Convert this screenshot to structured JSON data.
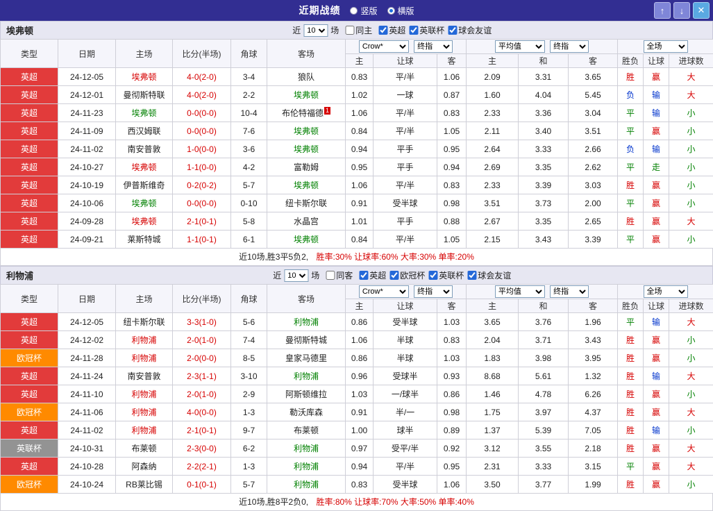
{
  "colors": {
    "topbar_bg": "#322e92",
    "epl_badge": "#e23b3b",
    "ucl_badge": "#ff8a00",
    "eflcup_badge": "#939393",
    "win_red": "#d60000",
    "draw_green": "#008000",
    "lose_blue": "#0033cc"
  },
  "topbar": {
    "title": "近期战绩",
    "layout_options": [
      {
        "label": "竖版",
        "selected": false
      },
      {
        "label": "横版",
        "selected": true
      }
    ],
    "up_icon": "↑",
    "down_icon": "↓",
    "close_icon": "✕"
  },
  "table_header": {
    "statics": [
      "类型",
      "日期",
      "主场",
      "比分(半场)",
      "角球",
      "客场"
    ],
    "selects": {
      "bookmaker": "Crow*",
      "final_asian": "终指",
      "average": "平均值",
      "final_euro": "终指",
      "scope": "全场"
    },
    "sub": [
      "主",
      "让球",
      "客",
      "主",
      "和",
      "客",
      "胜负",
      "让球",
      "进球数"
    ]
  },
  "sections": [
    {
      "team": "埃弗顿",
      "filter": {
        "near": "近",
        "count": "10",
        "matches": "场",
        "same_label": "同主",
        "same_checked": false,
        "competitions": [
          {
            "label": "英超",
            "checked": true
          },
          {
            "label": "英联杯",
            "checked": true
          },
          {
            "label": "球会友谊",
            "checked": true
          }
        ]
      },
      "rows": [
        {
          "league": "英超",
          "league_class": "epl",
          "date": "24-12-05",
          "home": "埃弗顿",
          "home_color": "red",
          "score": "4-0(2-0)",
          "corners": "3-4",
          "away": "狼队",
          "away_color": "black",
          "asian": [
            "0.83",
            "平/半",
            "1.06"
          ],
          "euro": [
            "2.09",
            "3.31",
            "3.65"
          ],
          "results": [
            [
              "胜",
              "red"
            ],
            [
              "赢",
              "red"
            ],
            [
              "大",
              "red"
            ]
          ]
        },
        {
          "league": "英超",
          "league_class": "epl",
          "date": "24-12-01",
          "home": "曼彻斯特联",
          "home_color": "black",
          "score": "4-0(2-0)",
          "corners": "2-2",
          "away": "埃弗顿",
          "away_color": "green",
          "asian": [
            "1.02",
            "一球",
            "0.87"
          ],
          "euro": [
            "1.60",
            "4.04",
            "5.45"
          ],
          "results": [
            [
              "负",
              "blue"
            ],
            [
              "输",
              "blue"
            ],
            [
              "大",
              "red"
            ]
          ]
        },
        {
          "league": "英超",
          "league_class": "epl",
          "date": "24-11-23",
          "home": "埃弗顿",
          "home_color": "green",
          "score": "0-0(0-0)",
          "corners": "10-4",
          "away": "布伦特福德",
          "away_color": "black",
          "away_badge": "1",
          "asian": [
            "1.06",
            "平/半",
            "0.83"
          ],
          "euro": [
            "2.33",
            "3.36",
            "3.04"
          ],
          "results": [
            [
              "平",
              "green"
            ],
            [
              "输",
              "blue"
            ],
            [
              "小",
              "green"
            ]
          ]
        },
        {
          "league": "英超",
          "league_class": "epl",
          "date": "24-11-09",
          "home": "西汉姆联",
          "home_color": "black",
          "score": "0-0(0-0)",
          "corners": "7-6",
          "away": "埃弗顿",
          "away_color": "green",
          "asian": [
            "0.84",
            "平/半",
            "1.05"
          ],
          "euro": [
            "2.11",
            "3.40",
            "3.51"
          ],
          "results": [
            [
              "平",
              "green"
            ],
            [
              "赢",
              "red"
            ],
            [
              "小",
              "green"
            ]
          ]
        },
        {
          "league": "英超",
          "league_class": "epl",
          "date": "24-11-02",
          "home": "南安普敦",
          "home_color": "black",
          "score": "1-0(0-0)",
          "corners": "3-6",
          "away": "埃弗顿",
          "away_color": "green",
          "asian": [
            "0.94",
            "平手",
            "0.95"
          ],
          "euro": [
            "2.64",
            "3.33",
            "2.66"
          ],
          "results": [
            [
              "负",
              "blue"
            ],
            [
              "输",
              "blue"
            ],
            [
              "小",
              "green"
            ]
          ]
        },
        {
          "league": "英超",
          "league_class": "epl",
          "date": "24-10-27",
          "home": "埃弗顿",
          "home_color": "red",
          "score": "1-1(0-0)",
          "corners": "4-2",
          "away": "富勒姆",
          "away_color": "black",
          "asian": [
            "0.95",
            "平手",
            "0.94"
          ],
          "euro": [
            "2.69",
            "3.35",
            "2.62"
          ],
          "results": [
            [
              "平",
              "green"
            ],
            [
              "走",
              "green"
            ],
            [
              "小",
              "green"
            ]
          ]
        },
        {
          "league": "英超",
          "league_class": "epl",
          "date": "24-10-19",
          "home": "伊普斯维奇",
          "home_color": "black",
          "score": "0-2(0-2)",
          "corners": "5-7",
          "away": "埃弗顿",
          "away_color": "green",
          "asian": [
            "1.06",
            "平/半",
            "0.83"
          ],
          "euro": [
            "2.33",
            "3.39",
            "3.03"
          ],
          "results": [
            [
              "胜",
              "red"
            ],
            [
              "赢",
              "red"
            ],
            [
              "小",
              "green"
            ]
          ]
        },
        {
          "league": "英超",
          "league_class": "epl",
          "date": "24-10-06",
          "home": "埃弗顿",
          "home_color": "green",
          "score": "0-0(0-0)",
          "corners": "0-10",
          "away": "纽卡斯尔联",
          "away_color": "black",
          "asian": [
            "0.91",
            "受半球",
            "0.98"
          ],
          "euro": [
            "3.51",
            "3.73",
            "2.00"
          ],
          "results": [
            [
              "平",
              "green"
            ],
            [
              "赢",
              "red"
            ],
            [
              "小",
              "green"
            ]
          ]
        },
        {
          "league": "英超",
          "league_class": "epl",
          "date": "24-09-28",
          "home": "埃弗顿",
          "home_color": "red",
          "score": "2-1(0-1)",
          "corners": "5-8",
          "away": "水晶宫",
          "away_color": "black",
          "asian": [
            "1.01",
            "平手",
            "0.88"
          ],
          "euro": [
            "2.67",
            "3.35",
            "2.65"
          ],
          "results": [
            [
              "胜",
              "red"
            ],
            [
              "赢",
              "red"
            ],
            [
              "大",
              "red"
            ]
          ]
        },
        {
          "league": "英超",
          "league_class": "epl",
          "date": "24-09-21",
          "home": "莱斯特城",
          "home_color": "black",
          "score": "1-1(0-1)",
          "corners": "6-1",
          "away": "埃弗顿",
          "away_color": "green",
          "asian": [
            "0.84",
            "平/半",
            "1.05"
          ],
          "euro": [
            "2.15",
            "3.43",
            "3.39"
          ],
          "results": [
            [
              "平",
              "green"
            ],
            [
              "赢",
              "red"
            ],
            [
              "小",
              "green"
            ]
          ]
        }
      ],
      "summary_plain": "近10场,胜3平5负2,",
      "summary_stats": "胜率:30% 让球率:60% 大率:30% 单率:20%"
    },
    {
      "team": "利物浦",
      "filter": {
        "near": "近",
        "count": "10",
        "matches": "场",
        "same_label": "同客",
        "same_checked": false,
        "competitions": [
          {
            "label": "英超",
            "checked": true
          },
          {
            "label": "欧冠杯",
            "checked": true
          },
          {
            "label": "英联杯",
            "checked": true
          },
          {
            "label": "球会友谊",
            "checked": true
          }
        ]
      },
      "rows": [
        {
          "league": "英超",
          "league_class": "epl",
          "date": "24-12-05",
          "home": "纽卡斯尔联",
          "home_color": "black",
          "score": "3-3(1-0)",
          "corners": "5-6",
          "away": "利物浦",
          "away_color": "green",
          "asian": [
            "0.86",
            "受半球",
            "1.03"
          ],
          "euro": [
            "3.65",
            "3.76",
            "1.96"
          ],
          "results": [
            [
              "平",
              "green"
            ],
            [
              "输",
              "blue"
            ],
            [
              "大",
              "red"
            ]
          ]
        },
        {
          "league": "英超",
          "league_class": "epl",
          "date": "24-12-02",
          "home": "利物浦",
          "home_color": "red",
          "score": "2-0(1-0)",
          "corners": "7-4",
          "away": "曼彻斯特城",
          "away_color": "black",
          "asian": [
            "1.06",
            "半球",
            "0.83"
          ],
          "euro": [
            "2.04",
            "3.71",
            "3.43"
          ],
          "results": [
            [
              "胜",
              "red"
            ],
            [
              "赢",
              "red"
            ],
            [
              "小",
              "green"
            ]
          ]
        },
        {
          "league": "欧冠杯",
          "league_class": "ucl",
          "date": "24-11-28",
          "home": "利物浦",
          "home_color": "red",
          "score": "2-0(0-0)",
          "corners": "8-5",
          "away": "皇家马德里",
          "away_color": "black",
          "asian": [
            "0.86",
            "半球",
            "1.03"
          ],
          "euro": [
            "1.83",
            "3.98",
            "3.95"
          ],
          "results": [
            [
              "胜",
              "red"
            ],
            [
              "赢",
              "red"
            ],
            [
              "小",
              "green"
            ]
          ]
        },
        {
          "league": "英超",
          "league_class": "epl",
          "date": "24-11-24",
          "home": "南安普敦",
          "home_color": "black",
          "score": "2-3(1-1)",
          "corners": "3-10",
          "away": "利物浦",
          "away_color": "green",
          "asian": [
            "0.96",
            "受球半",
            "0.93"
          ],
          "euro": [
            "8.68",
            "5.61",
            "1.32"
          ],
          "results": [
            [
              "胜",
              "red"
            ],
            [
              "输",
              "blue"
            ],
            [
              "大",
              "red"
            ]
          ]
        },
        {
          "league": "英超",
          "league_class": "epl",
          "date": "24-11-10",
          "home": "利物浦",
          "home_color": "red",
          "score": "2-0(1-0)",
          "corners": "2-9",
          "away": "阿斯顿维拉",
          "away_color": "black",
          "asian": [
            "1.03",
            "一/球半",
            "0.86"
          ],
          "euro": [
            "1.46",
            "4.78",
            "6.26"
          ],
          "results": [
            [
              "胜",
              "red"
            ],
            [
              "赢",
              "red"
            ],
            [
              "小",
              "green"
            ]
          ]
        },
        {
          "league": "欧冠杯",
          "league_class": "ucl",
          "date": "24-11-06",
          "home": "利物浦",
          "home_color": "red",
          "score": "4-0(0-0)",
          "corners": "1-3",
          "away": "勒沃库森",
          "away_color": "black",
          "asian": [
            "0.91",
            "半/一",
            "0.98"
          ],
          "euro": [
            "1.75",
            "3.97",
            "4.37"
          ],
          "results": [
            [
              "胜",
              "red"
            ],
            [
              "赢",
              "red"
            ],
            [
              "大",
              "red"
            ]
          ]
        },
        {
          "league": "英超",
          "league_class": "epl",
          "date": "24-11-02",
          "home": "利物浦",
          "home_color": "red",
          "score": "2-1(0-1)",
          "corners": "9-7",
          "away": "布莱顿",
          "away_color": "black",
          "asian": [
            "1.00",
            "球半",
            "0.89"
          ],
          "euro": [
            "1.37",
            "5.39",
            "7.05"
          ],
          "results": [
            [
              "胜",
              "red"
            ],
            [
              "输",
              "blue"
            ],
            [
              "小",
              "green"
            ]
          ]
        },
        {
          "league": "英联杯",
          "league_class": "cup",
          "date": "24-10-31",
          "home": "布莱顿",
          "home_color": "black",
          "score": "2-3(0-0)",
          "corners": "6-2",
          "away": "利物浦",
          "away_color": "green",
          "asian": [
            "0.97",
            "受平/半",
            "0.92"
          ],
          "euro": [
            "3.12",
            "3.55",
            "2.18"
          ],
          "results": [
            [
              "胜",
              "red"
            ],
            [
              "赢",
              "red"
            ],
            [
              "大",
              "red"
            ]
          ]
        },
        {
          "league": "英超",
          "league_class": "epl",
          "date": "24-10-28",
          "home": "阿森纳",
          "home_color": "black",
          "score": "2-2(2-1)",
          "corners": "1-3",
          "away": "利物浦",
          "away_color": "green",
          "asian": [
            "0.94",
            "平/半",
            "0.95"
          ],
          "euro": [
            "2.31",
            "3.33",
            "3.15"
          ],
          "results": [
            [
              "平",
              "green"
            ],
            [
              "赢",
              "red"
            ],
            [
              "大",
              "red"
            ]
          ]
        },
        {
          "league": "欧冠杯",
          "league_class": "ucl",
          "date": "24-10-24",
          "home": "RB莱比锡",
          "home_color": "black",
          "score": "0-1(0-1)",
          "corners": "5-7",
          "away": "利物浦",
          "away_color": "green",
          "asian": [
            "0.83",
            "受半球",
            "1.06"
          ],
          "euro": [
            "3.50",
            "3.77",
            "1.99"
          ],
          "results": [
            [
              "胜",
              "red"
            ],
            [
              "赢",
              "red"
            ],
            [
              "小",
              "green"
            ]
          ]
        }
      ],
      "summary_plain": "近10场,胜8平2负0,",
      "summary_stats": "胜率:80% 让球率:70% 大率:50% 单率:40%"
    }
  ]
}
